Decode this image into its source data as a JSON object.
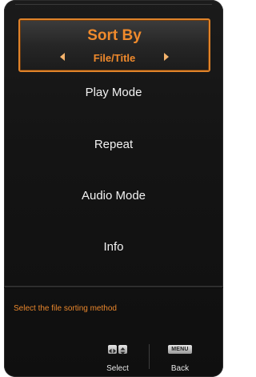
{
  "menu": {
    "selected_title": "Sort By",
    "selected_value": "File/Title",
    "items": [
      {
        "label": "Play Mode"
      },
      {
        "label": "Repeat"
      },
      {
        "label": "Audio Mode"
      },
      {
        "label": "Info"
      }
    ]
  },
  "hint": "Select the file sorting method",
  "help": {
    "select_label": "Select",
    "back_key": "MENU",
    "back_label": "Back"
  },
  "icons": {
    "left_arrow": "left-arrow-icon",
    "right_arrow": "right-arrow-icon",
    "nav_lr": "left-right-keys-icon",
    "nav_ud": "up-down-keys-icon",
    "menu_key": "menu-key-icon"
  },
  "colors": {
    "accent": "#e0832a",
    "accent_text": "#f08a2c",
    "panel": "#141414",
    "text": "#f2f2f2"
  }
}
